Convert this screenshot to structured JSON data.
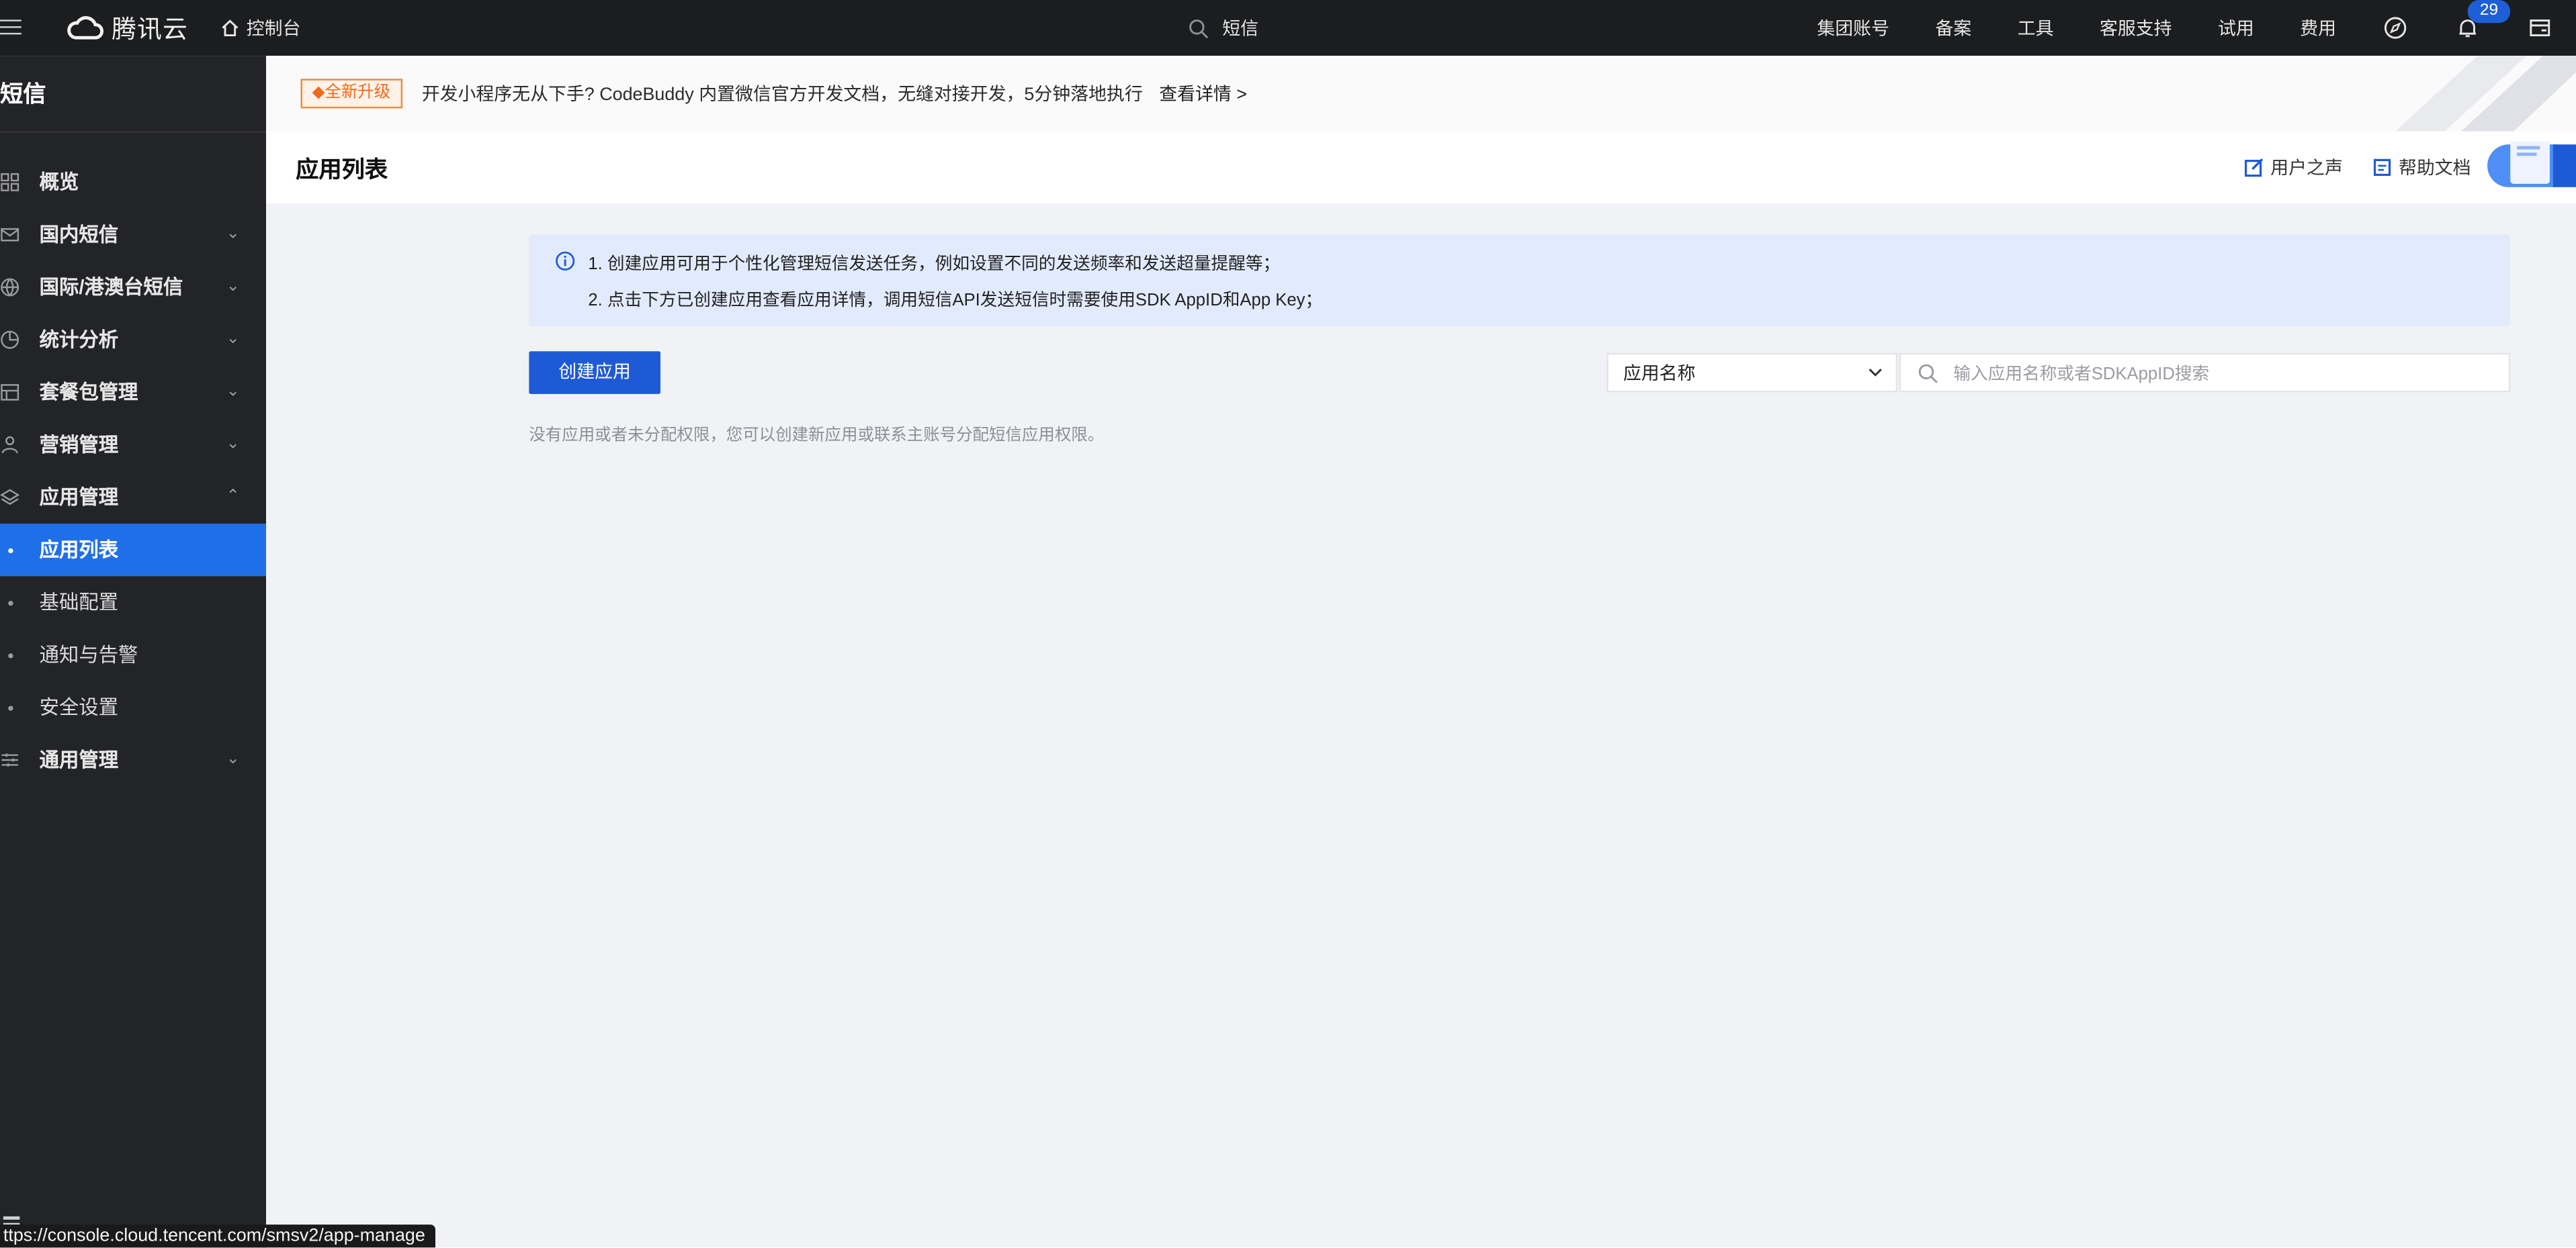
{
  "topbar": {
    "brand": "腾讯云",
    "console_label": "控制台",
    "search_text": "短信",
    "nav": [
      "集团账号",
      "备案",
      "工具",
      "客服支持",
      "试用",
      "费用"
    ],
    "notification_count": "29",
    "icons": [
      "menu-icon",
      "cloud-logo-icon",
      "home-icon",
      "search-icon",
      "compass-icon",
      "bell-icon",
      "inbox-icon"
    ]
  },
  "sidebar": {
    "title": "短信",
    "items": [
      {
        "label": "概览",
        "icon": "grid-icon",
        "chevron": ""
      },
      {
        "label": "国内短信",
        "icon": "mail-icon",
        "chevron": "⌄"
      },
      {
        "label": "国际/港澳台短信",
        "icon": "globe-icon",
        "chevron": "⌄"
      },
      {
        "label": "统计分析",
        "icon": "pie-chart-icon",
        "chevron": "⌄"
      },
      {
        "label": "套餐包管理",
        "icon": "package-icon",
        "chevron": "⌄"
      },
      {
        "label": "营销管理",
        "icon": "user-group-icon",
        "chevron": "⌄"
      },
      {
        "label": "应用管理",
        "icon": "layers-icon",
        "chevron": "⌃"
      }
    ],
    "sub_items": [
      "应用列表",
      "基础配置",
      "通知与告警",
      "安全设置"
    ],
    "general": {
      "label": "通用管理",
      "icon": "sliders-icon",
      "chevron": "⌄"
    }
  },
  "status_url": "ttps://console.cloud.tencent.com/smsv2/app-manage",
  "banner": {
    "tag": "◆全新升级",
    "text": "开发小程序无从下手? CodeBuddy 内置微信官方开发文档，无缝对接开发，5分钟落地执行",
    "link": "查看详情 >"
  },
  "header": {
    "title": "应用列表",
    "actions": [
      "用户之声",
      "帮助文档"
    ]
  },
  "info": {
    "line1": "1. 创建应用可用于个性化管理短信发送任务，例如设置不同的发送频率和发送超量提醒等；",
    "line2": "2. 点击下方已创建应用查看应用详情，调用短信API发送短信时需要使用SDK AppID和App Key；"
  },
  "actions": {
    "create_label": "创建应用",
    "filter_selected": "应用名称",
    "search_placeholder": "输入应用名称或者SDKAppID搜索",
    "search_value": ""
  },
  "empty_note": "没有应用或者未分配权限，您可以创建新应用或联系主账号分配短信应用权限。",
  "colors": {
    "topbar": "#1c1d1f",
    "sidebar": "#232427",
    "active": "#1f6fe8",
    "primary_button": "#1e5ad6",
    "info_bg": "#e2ebfd",
    "badge": "#1f5fd6"
  }
}
